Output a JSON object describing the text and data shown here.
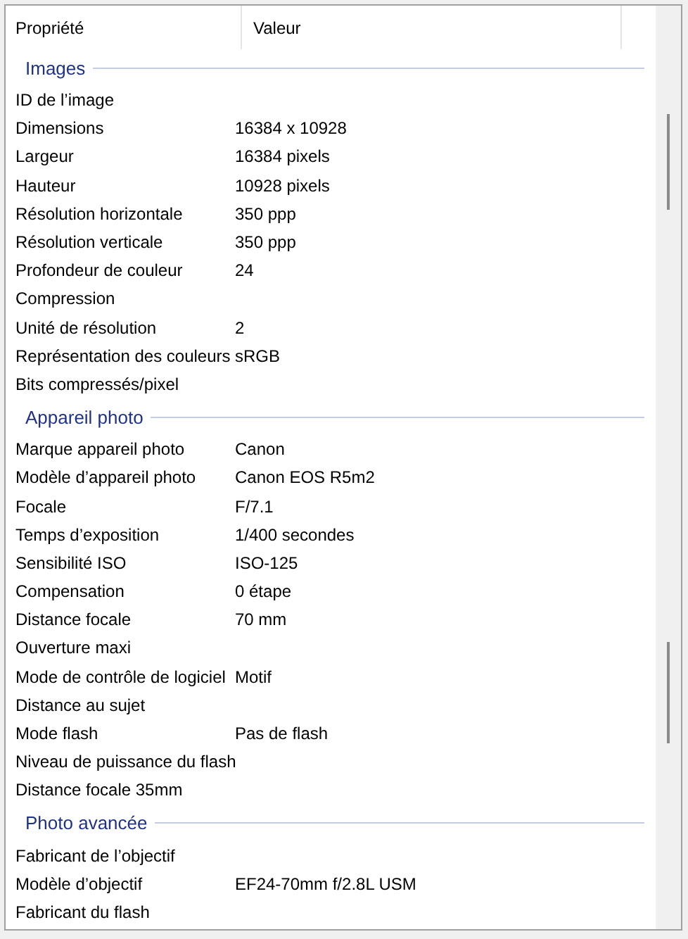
{
  "columns": [
    "Propriété",
    "Valeur"
  ],
  "groups": [
    {
      "title": "Images",
      "rows": [
        {
          "label": "ID de l’image"
        },
        {
          "label": "Dimensions",
          "value": "16384 x 10928"
        },
        {
          "label": "Largeur",
          "value": "16384 pixels"
        },
        {
          "label": "Hauteur",
          "value": "10928 pixels"
        },
        {
          "label": "Résolution horizontale",
          "value": "350 ppp"
        },
        {
          "label": "Résolution verticale",
          "value": "350 ppp"
        },
        {
          "label": "Profondeur de couleur",
          "value": "24"
        },
        {
          "label": "Compression"
        },
        {
          "label": "Unité de résolution",
          "value": "2"
        },
        {
          "label": "Représentation des couleurs",
          "value": "sRGB"
        },
        {
          "label": "Bits compressés/pixel"
        }
      ]
    },
    {
      "title": "Appareil photo",
      "rows": [
        {
          "label": "Marque appareil photo",
          "value": "Canon"
        },
        {
          "label": "Modèle d’appareil photo",
          "value": "Canon EOS R5m2"
        },
        {
          "label": "Focale",
          "value": "F/7.1"
        },
        {
          "label": "Temps d’exposition",
          "value": "1/400 secondes"
        },
        {
          "label": "Sensibilité ISO",
          "value": "ISO-125"
        },
        {
          "label": "Compensation",
          "value": "0 étape"
        },
        {
          "label": "Distance focale",
          "value": "70 mm"
        },
        {
          "label": "Ouverture maxi"
        },
        {
          "label": "Mode de contrôle de logiciel",
          "value": "Motif"
        },
        {
          "label": "Distance au sujet"
        },
        {
          "label": "Mode flash",
          "value": "Pas de flash"
        },
        {
          "label": "Niveau de puissance du flash"
        },
        {
          "label": "Distance focale 35mm"
        }
      ]
    },
    {
      "title": "Photo avancée",
      "rows": [
        {
          "label": "Fabricant de l’objectif"
        },
        {
          "label": "Modèle d’objectif",
          "value": "EF24-70mm f/2.8L USM"
        },
        {
          "label": "Fabricant du flash"
        }
      ]
    }
  ]
}
